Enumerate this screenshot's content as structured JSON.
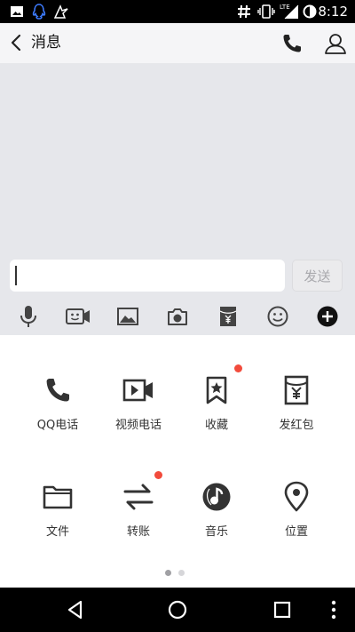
{
  "status_bar": {
    "time": "8:12",
    "network": "LTE",
    "icons": [
      "image-icon",
      "qq-icon",
      "notification-icon",
      "hash-icon",
      "vibrate-icon",
      "signal-icon",
      "battery-icon"
    ]
  },
  "header": {
    "back_icon": "chevron-left-icon",
    "title": "消息",
    "right_icons": [
      "phone-icon",
      "person-icon"
    ]
  },
  "composer": {
    "input_value": "",
    "send_label": "发送"
  },
  "toolbar": {
    "items": [
      "microphone-icon",
      "video-message-icon",
      "image-icon",
      "camera-icon",
      "red-packet-icon",
      "emoji-icon",
      "plus-icon"
    ]
  },
  "panel": {
    "items": [
      {
        "label": "QQ电话",
        "icon": "phone-icon",
        "badge": false
      },
      {
        "label": "视频电话",
        "icon": "video-call-icon",
        "badge": false
      },
      {
        "label": "收藏",
        "icon": "bookmark-star-icon",
        "badge": true
      },
      {
        "label": "发红包",
        "icon": "red-packet-icon",
        "badge": false
      },
      {
        "label": "文件",
        "icon": "folder-icon",
        "badge": false
      },
      {
        "label": "转账",
        "icon": "transfer-icon",
        "badge": true
      },
      {
        "label": "音乐",
        "icon": "music-icon",
        "badge": false
      },
      {
        "label": "位置",
        "icon": "location-icon",
        "badge": false
      }
    ],
    "page_count": 2,
    "active_page": 1
  },
  "navigation": {
    "buttons": [
      "back-triangle-icon",
      "home-circle-icon",
      "recents-square-icon",
      "more-icon"
    ]
  },
  "colors": {
    "badge": "#f24b3c",
    "icon": "#333333",
    "chat_background": "#e6e7eb"
  }
}
